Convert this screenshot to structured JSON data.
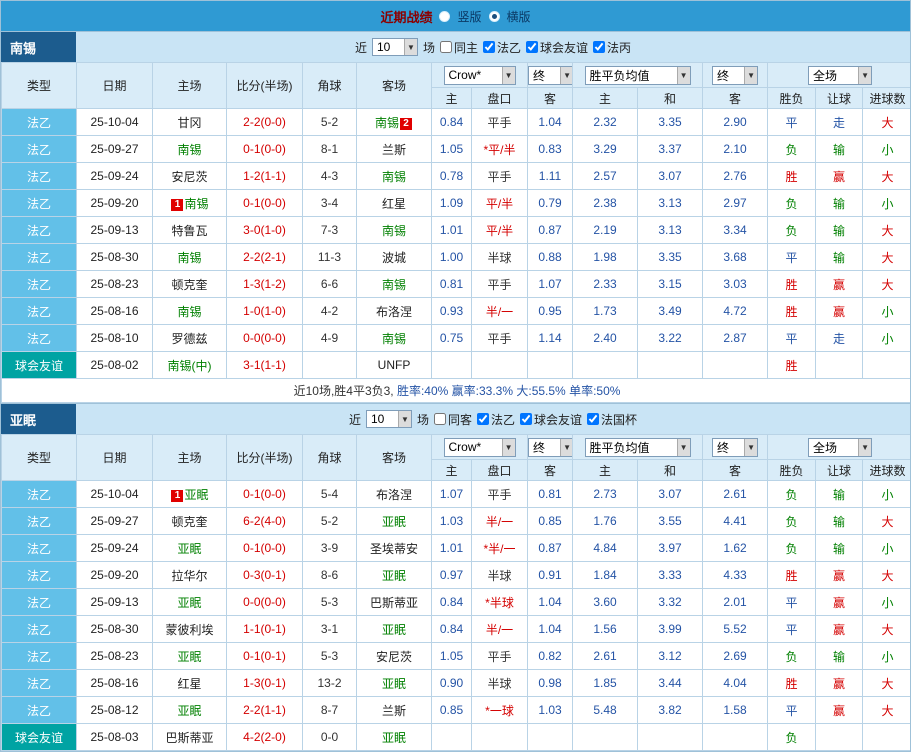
{
  "top_bar": {
    "title": "近期战绩",
    "view_options": [
      {
        "label": "竖版",
        "selected": false
      },
      {
        "label": "横版",
        "selected": true
      }
    ]
  },
  "table_columns": {
    "left": [
      "类型",
      "日期",
      "主场",
      "比分(半场)",
      "角球",
      "客场"
    ],
    "odds_sub": [
      "主",
      "盘口",
      "客"
    ],
    "avg_sub": [
      "主",
      "和",
      "客"
    ],
    "result_sub": [
      "胜负",
      "让球",
      "进球数"
    ]
  },
  "colors": {
    "win": "#d40000",
    "draw": "#2453a5",
    "lose": "#008000",
    "neutral": "#333333"
  },
  "sections": [
    {
      "team": "南锡",
      "filter": {
        "near_label": "近",
        "count": "10",
        "games_label": "场",
        "checkboxes": [
          {
            "label": "同主",
            "checked": false
          },
          {
            "label": "法乙",
            "checked": true
          },
          {
            "label": "球会友谊",
            "checked": true
          },
          {
            "label": "法丙",
            "checked": true
          }
        ]
      },
      "selects": {
        "bookmaker": "Crow*",
        "final1": "终",
        "avg": "胜平负均值",
        "final2": "终",
        "scope": "全场"
      },
      "rows": [
        {
          "type": "法乙",
          "friendly": false,
          "date": "25-10-04",
          "home": {
            "name": "甘冈"
          },
          "score": "2-2(0-0)",
          "corners": "5-2",
          "away": {
            "name": "南锡",
            "green": true,
            "badge": "2",
            "badge_pos": "after"
          },
          "odds": [
            "0.84",
            "平手",
            "1.04"
          ],
          "hot": false,
          "avg": [
            "2.32",
            "3.35",
            "2.90"
          ],
          "result": "平",
          "handicap": "走",
          "goals": "大"
        },
        {
          "type": "法乙",
          "friendly": false,
          "date": "25-09-27",
          "home": {
            "name": "南锡",
            "green": true
          },
          "score": "0-1(0-0)",
          "corners": "8-1",
          "away": {
            "name": "兰斯"
          },
          "odds": [
            "1.05",
            "*平/半",
            "0.83"
          ],
          "hot": true,
          "avg": [
            "3.29",
            "3.37",
            "2.10"
          ],
          "result": "负",
          "handicap": "输",
          "goals": "小"
        },
        {
          "type": "法乙",
          "friendly": false,
          "date": "25-09-24",
          "home": {
            "name": "安尼茨"
          },
          "score": "1-2(1-1)",
          "corners": "4-3",
          "away": {
            "name": "南锡",
            "green": true
          },
          "odds": [
            "0.78",
            "平手",
            "1.11"
          ],
          "hot": false,
          "avg": [
            "2.57",
            "3.07",
            "2.76"
          ],
          "result": "胜",
          "handicap": "赢",
          "goals": "大"
        },
        {
          "type": "法乙",
          "friendly": false,
          "date": "25-09-20",
          "home": {
            "name": "南锡",
            "green": true,
            "badge": "1",
            "badge_pos": "before"
          },
          "score": "0-1(0-0)",
          "corners": "3-4",
          "away": {
            "name": "红星"
          },
          "odds": [
            "1.09",
            "平/半",
            "0.79"
          ],
          "hot": true,
          "avg": [
            "2.38",
            "3.13",
            "2.97"
          ],
          "result": "负",
          "handicap": "输",
          "goals": "小"
        },
        {
          "type": "法乙",
          "friendly": false,
          "date": "25-09-13",
          "home": {
            "name": "特鲁瓦"
          },
          "score": "3-0(1-0)",
          "corners": "7-3",
          "away": {
            "name": "南锡",
            "green": true
          },
          "odds": [
            "1.01",
            "平/半",
            "0.87"
          ],
          "hot": true,
          "avg": [
            "2.19",
            "3.13",
            "3.34"
          ],
          "result": "负",
          "handicap": "输",
          "goals": "大"
        },
        {
          "type": "法乙",
          "friendly": false,
          "date": "25-08-30",
          "home": {
            "name": "南锡",
            "green": true
          },
          "score": "2-2(2-1)",
          "corners": "11-3",
          "away": {
            "name": "波城"
          },
          "odds": [
            "1.00",
            "半球",
            "0.88"
          ],
          "hot": false,
          "avg": [
            "1.98",
            "3.35",
            "3.68"
          ],
          "result": "平",
          "handicap": "输",
          "goals": "大"
        },
        {
          "type": "法乙",
          "friendly": false,
          "date": "25-08-23",
          "home": {
            "name": "顿克奎"
          },
          "score": "1-3(1-2)",
          "corners": "6-6",
          "away": {
            "name": "南锡",
            "green": true
          },
          "odds": [
            "0.81",
            "平手",
            "1.07"
          ],
          "hot": false,
          "avg": [
            "2.33",
            "3.15",
            "3.03"
          ],
          "result": "胜",
          "handicap": "赢",
          "goals": "大"
        },
        {
          "type": "法乙",
          "friendly": false,
          "date": "25-08-16",
          "home": {
            "name": "南锡",
            "green": true
          },
          "score": "1-0(1-0)",
          "corners": "4-2",
          "away": {
            "name": "布洛涅"
          },
          "odds": [
            "0.93",
            "半/一",
            "0.95"
          ],
          "hot": true,
          "avg": [
            "1.73",
            "3.49",
            "4.72"
          ],
          "result": "胜",
          "handicap": "赢",
          "goals": "小"
        },
        {
          "type": "法乙",
          "friendly": false,
          "date": "25-08-10",
          "home": {
            "name": "罗德兹"
          },
          "score": "0-0(0-0)",
          "corners": "4-9",
          "away": {
            "name": "南锡",
            "green": true
          },
          "odds": [
            "0.75",
            "平手",
            "1.14"
          ],
          "hot": false,
          "avg": [
            "2.40",
            "3.22",
            "2.87"
          ],
          "result": "平",
          "handicap": "走",
          "goals": "小"
        },
        {
          "type": "球会友谊",
          "friendly": true,
          "date": "25-08-02",
          "home": {
            "name": "南锡(中)",
            "green": true
          },
          "score": "3-1(1-1)",
          "corners": "",
          "away": {
            "name": "UNFP"
          },
          "odds": [
            "",
            "",
            ""
          ],
          "hot": false,
          "avg": [
            "",
            "",
            ""
          ],
          "result": "胜",
          "handicap": "",
          "goals": ""
        }
      ],
      "summary": [
        {
          "text": "近10场,胜4平3负3, ",
          "color": "#333333"
        },
        {
          "text": "胜率:40% ",
          "color": "#2453a5"
        },
        {
          "text": "赢率:33.3% ",
          "color": "#2453a5"
        },
        {
          "text": "大:55.5% ",
          "color": "#2453a5"
        },
        {
          "text": "单率:50%",
          "color": "#2453a5"
        }
      ]
    },
    {
      "team": "亚眠",
      "filter": {
        "near_label": "近",
        "count": "10",
        "games_label": "场",
        "checkboxes": [
          {
            "label": "同客",
            "checked": false
          },
          {
            "label": "法乙",
            "checked": true
          },
          {
            "label": "球会友谊",
            "checked": true
          },
          {
            "label": "法国杯",
            "checked": true
          }
        ]
      },
      "selects": {
        "bookmaker": "Crow*",
        "final1": "终",
        "avg": "胜平负均值",
        "final2": "终",
        "scope": "全场"
      },
      "rows": [
        {
          "type": "法乙",
          "friendly": false,
          "date": "25-10-04",
          "home": {
            "name": "亚眠",
            "green": true,
            "badge": "1",
            "badge_pos": "before"
          },
          "score": "0-1(0-0)",
          "corners": "5-4",
          "away": {
            "name": "布洛涅"
          },
          "odds": [
            "1.07",
            "平手",
            "0.81"
          ],
          "hot": false,
          "avg": [
            "2.73",
            "3.07",
            "2.61"
          ],
          "result": "负",
          "handicap": "输",
          "goals": "小"
        },
        {
          "type": "法乙",
          "friendly": false,
          "date": "25-09-27",
          "home": {
            "name": "顿克奎"
          },
          "score": "6-2(4-0)",
          "corners": "5-2",
          "away": {
            "name": "亚眠",
            "green": true
          },
          "odds": [
            "1.03",
            "半/一",
            "0.85"
          ],
          "hot": true,
          "avg": [
            "1.76",
            "3.55",
            "4.41"
          ],
          "result": "负",
          "handicap": "输",
          "goals": "大"
        },
        {
          "type": "法乙",
          "friendly": false,
          "date": "25-09-24",
          "home": {
            "name": "亚眠",
            "green": true
          },
          "score": "0-1(0-0)",
          "corners": "3-9",
          "away": {
            "name": "圣埃蒂安"
          },
          "odds": [
            "1.01",
            "*半/一",
            "0.87"
          ],
          "hot": true,
          "avg": [
            "4.84",
            "3.97",
            "1.62"
          ],
          "result": "负",
          "handicap": "输",
          "goals": "小"
        },
        {
          "type": "法乙",
          "friendly": false,
          "date": "25-09-20",
          "home": {
            "name": "拉华尔"
          },
          "score": "0-3(0-1)",
          "corners": "8-6",
          "away": {
            "name": "亚眠",
            "green": true
          },
          "odds": [
            "0.97",
            "半球",
            "0.91"
          ],
          "hot": false,
          "avg": [
            "1.84",
            "3.33",
            "4.33"
          ],
          "result": "胜",
          "handicap": "赢",
          "goals": "大"
        },
        {
          "type": "法乙",
          "friendly": false,
          "date": "25-09-13",
          "home": {
            "name": "亚眠",
            "green": true
          },
          "score": "0-0(0-0)",
          "corners": "5-3",
          "away": {
            "name": "巴斯蒂亚"
          },
          "odds": [
            "0.84",
            "*半球",
            "1.04"
          ],
          "hot": true,
          "avg": [
            "3.60",
            "3.32",
            "2.01"
          ],
          "result": "平",
          "handicap": "赢",
          "goals": "小"
        },
        {
          "type": "法乙",
          "friendly": false,
          "date": "25-08-30",
          "home": {
            "name": "蒙彼利埃"
          },
          "score": "1-1(0-1)",
          "corners": "3-1",
          "away": {
            "name": "亚眠",
            "green": true
          },
          "odds": [
            "0.84",
            "半/一",
            "1.04"
          ],
          "hot": true,
          "avg": [
            "1.56",
            "3.99",
            "5.52"
          ],
          "result": "平",
          "handicap": "赢",
          "goals": "大"
        },
        {
          "type": "法乙",
          "friendly": false,
          "date": "25-08-23",
          "home": {
            "name": "亚眠",
            "green": true
          },
          "score": "0-1(0-1)",
          "corners": "5-3",
          "away": {
            "name": "安尼茨"
          },
          "odds": [
            "1.05",
            "平手",
            "0.82"
          ],
          "hot": false,
          "avg": [
            "2.61",
            "3.12",
            "2.69"
          ],
          "result": "负",
          "handicap": "输",
          "goals": "小"
        },
        {
          "type": "法乙",
          "friendly": false,
          "date": "25-08-16",
          "home": {
            "name": "红星"
          },
          "score": "1-3(0-1)",
          "corners": "13-2",
          "away": {
            "name": "亚眠",
            "green": true
          },
          "odds": [
            "0.90",
            "半球",
            "0.98"
          ],
          "hot": false,
          "avg": [
            "1.85",
            "3.44",
            "4.04"
          ],
          "result": "胜",
          "handicap": "赢",
          "goals": "大"
        },
        {
          "type": "法乙",
          "friendly": false,
          "date": "25-08-12",
          "home": {
            "name": "亚眠",
            "green": true
          },
          "score": "2-2(1-1)",
          "corners": "8-7",
          "away": {
            "name": "兰斯"
          },
          "odds": [
            "0.85",
            "*一球",
            "1.03"
          ],
          "hot": true,
          "avg": [
            "5.48",
            "3.82",
            "1.58"
          ],
          "result": "平",
          "handicap": "赢",
          "goals": "大"
        },
        {
          "type": "球会友谊",
          "friendly": true,
          "date": "25-08-03",
          "home": {
            "name": "巴斯蒂亚"
          },
          "score": "4-2(2-0)",
          "corners": "0-0",
          "away": {
            "name": "亚眠",
            "green": true
          },
          "odds": [
            "",
            "",
            ""
          ],
          "hot": false,
          "avg": [
            "",
            "",
            ""
          ],
          "result": "负",
          "handicap": "",
          "goals": ""
        }
      ],
      "summary": []
    }
  ]
}
